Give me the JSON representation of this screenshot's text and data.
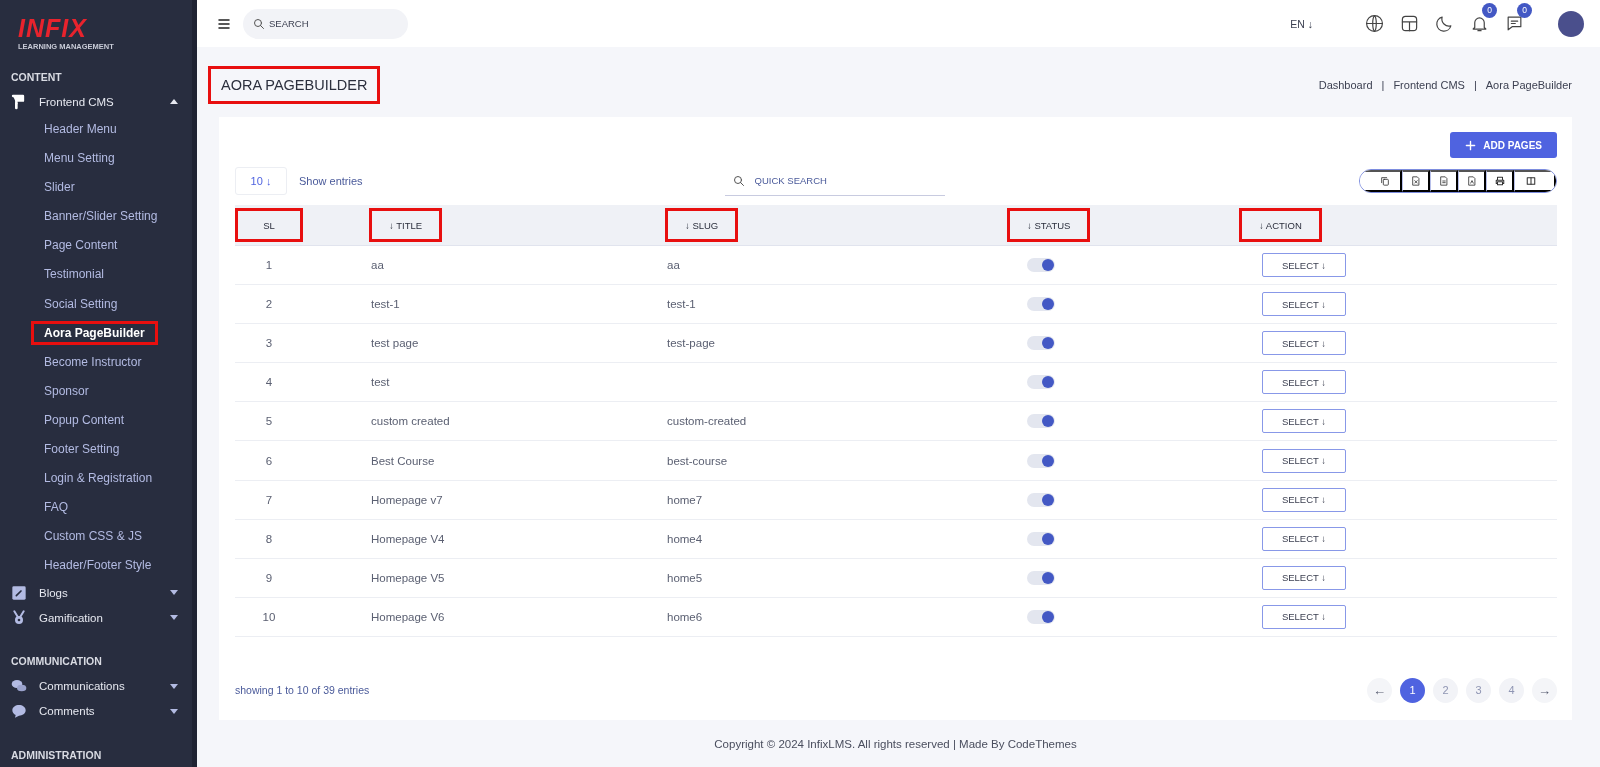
{
  "logo": {
    "brand": "INFIX",
    "tagline": "LEARNING MANAGEMENT"
  },
  "sidebar": {
    "sections": [
      {
        "title": "CONTENT",
        "items": [
          {
            "label": "Frontend CMS",
            "expanded": true,
            "children": [
              {
                "label": "Header Menu",
                "selected": false,
                "highlighted": false
              },
              {
                "label": "Menu Setting",
                "selected": false,
                "highlighted": false
              },
              {
                "label": "Slider",
                "selected": false,
                "highlighted": false
              },
              {
                "label": "Banner/Slider Setting",
                "selected": false,
                "highlighted": false
              },
              {
                "label": "Page Content",
                "selected": false,
                "highlighted": false
              },
              {
                "label": "Testimonial",
                "selected": false,
                "highlighted": false
              },
              {
                "label": "Social Setting",
                "selected": false,
                "highlighted": false
              },
              {
                "label": "Aora PageBuilder",
                "selected": true,
                "highlighted": true
              },
              {
                "label": "Become Instructor",
                "selected": false,
                "highlighted": false
              },
              {
                "label": "Sponsor",
                "selected": false,
                "highlighted": false
              },
              {
                "label": "Popup Content",
                "selected": false,
                "highlighted": false
              },
              {
                "label": "Footer Setting",
                "selected": false,
                "highlighted": false
              },
              {
                "label": "Login & Registration",
                "selected": false,
                "highlighted": false
              },
              {
                "label": "FAQ",
                "selected": false,
                "highlighted": false
              },
              {
                "label": "Custom CSS & JS",
                "selected": false,
                "highlighted": false
              },
              {
                "label": "Header/Footer Style",
                "selected": false,
                "highlighted": false
              }
            ]
          },
          {
            "label": "Blogs",
            "expanded": false
          },
          {
            "label": "Gamification",
            "expanded": false
          }
        ]
      },
      {
        "title": "COMMUNICATION",
        "items": [
          {
            "label": "Communications",
            "expanded": false
          },
          {
            "label": "Comments",
            "expanded": false
          }
        ]
      },
      {
        "title": "ADMINISTRATION"
      }
    ]
  },
  "topbar": {
    "search_placeholder": "SEARCH",
    "language": "EN ↓",
    "notifications_count": "0",
    "messages_count": "0"
  },
  "page_title": {
    "text": "AORA PAGEBUILDER",
    "highlighted": true
  },
  "breadcrumb": {
    "separator": "|",
    "items": [
      "Dashboard",
      "Frontend CMS",
      "Aora PageBuilder"
    ]
  },
  "add_button": "ADD PAGES",
  "entries": {
    "value": "10 ↓",
    "label": "Show entries"
  },
  "quick_search_placeholder": "QUICK SEARCH",
  "table": {
    "columns": [
      {
        "label": "SL",
        "highlighted": true
      },
      {
        "label": "↓ TITLE",
        "highlighted": true
      },
      {
        "label": "↓ SLUG",
        "highlighted": true
      },
      {
        "label": "↓ STATUS",
        "highlighted": true
      },
      {
        "label": "↓ ACTION",
        "highlighted": true
      }
    ],
    "rows": [
      {
        "sl": "1",
        "title": "aa",
        "slug": "aa",
        "status_on": true,
        "action": "SELECT ↓"
      },
      {
        "sl": "2",
        "title": "test-1",
        "slug": "test-1",
        "status_on": true,
        "action": "SELECT ↓"
      },
      {
        "sl": "3",
        "title": "test page",
        "slug": "test-page",
        "status_on": true,
        "action": "SELECT ↓"
      },
      {
        "sl": "4",
        "title": "test",
        "status_on": true,
        "action": "SELECT ↓"
      },
      {
        "sl": "5",
        "title": "custom created",
        "slug": "custom-created",
        "status_on": true,
        "action": "SELECT ↓"
      },
      {
        "sl": "6",
        "title": "Best Course",
        "slug": "best-course",
        "status_on": true,
        "action": "SELECT ↓"
      },
      {
        "sl": "7",
        "title": "Homepage v7",
        "slug": "home7",
        "status_on": true,
        "action": "SELECT ↓"
      },
      {
        "sl": "8",
        "title": "Homepage V4",
        "slug": "home4",
        "status_on": true,
        "action": "SELECT ↓"
      },
      {
        "sl": "9",
        "title": "Homepage V5",
        "slug": "home5",
        "status_on": true,
        "action": "SELECT ↓"
      },
      {
        "sl": "10",
        "title": "Homepage V6",
        "slug": "home6",
        "status_on": true,
        "action": "SELECT ↓"
      }
    ]
  },
  "showing": "showing 1 to 10 of 39 entries",
  "pagination": [
    {
      "label": "←",
      "kind": "prev",
      "selected": false
    },
    {
      "label": "1",
      "kind": "page",
      "selected": true
    },
    {
      "label": "2",
      "kind": "page",
      "selected": false
    },
    {
      "label": "3",
      "kind": "page",
      "selected": false
    },
    {
      "label": "4",
      "kind": "page",
      "selected": false
    },
    {
      "label": "→",
      "kind": "next",
      "selected": false
    }
  ],
  "footer": "Copyright © 2024 InfixLMS. All rights reserved | Made By CodeThemes"
}
